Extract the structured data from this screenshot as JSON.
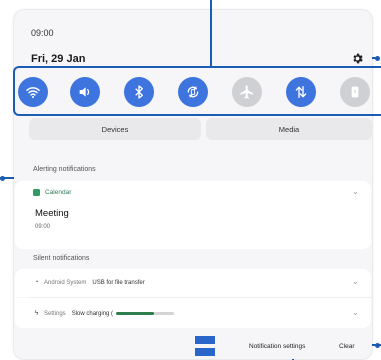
{
  "status": {
    "time": "09:00",
    "date": "Fri, 29 Jan"
  },
  "quick_settings": [
    {
      "icon": "wifi-icon",
      "active": true
    },
    {
      "icon": "sound-icon",
      "active": true
    },
    {
      "icon": "bluetooth-icon",
      "active": true
    },
    {
      "icon": "auto-rotate-icon",
      "active": true
    },
    {
      "icon": "airplane-icon",
      "active": false
    },
    {
      "icon": "mobile-data-icon",
      "active": true
    },
    {
      "icon": "flashlight-icon",
      "active": false
    }
  ],
  "buttons": {
    "devices": "Devices",
    "media": "Media"
  },
  "alerting": {
    "label": "Alerting notifications",
    "app": "Calendar",
    "title": "Meeting",
    "subtitle": "09:00"
  },
  "silent": {
    "label": "Silent notifications",
    "items": [
      {
        "app": "Android System",
        "message": "USB for file transfer"
      },
      {
        "app": "Settings",
        "message": "Slow charging (",
        "progress": 0.65
      }
    ]
  },
  "footer": {
    "notification_settings": "Notification settings",
    "clear": "Clear"
  },
  "colors": {
    "accent": "#3d74de",
    "callout": "#1c5db3",
    "calendar": "#2f9a61"
  }
}
